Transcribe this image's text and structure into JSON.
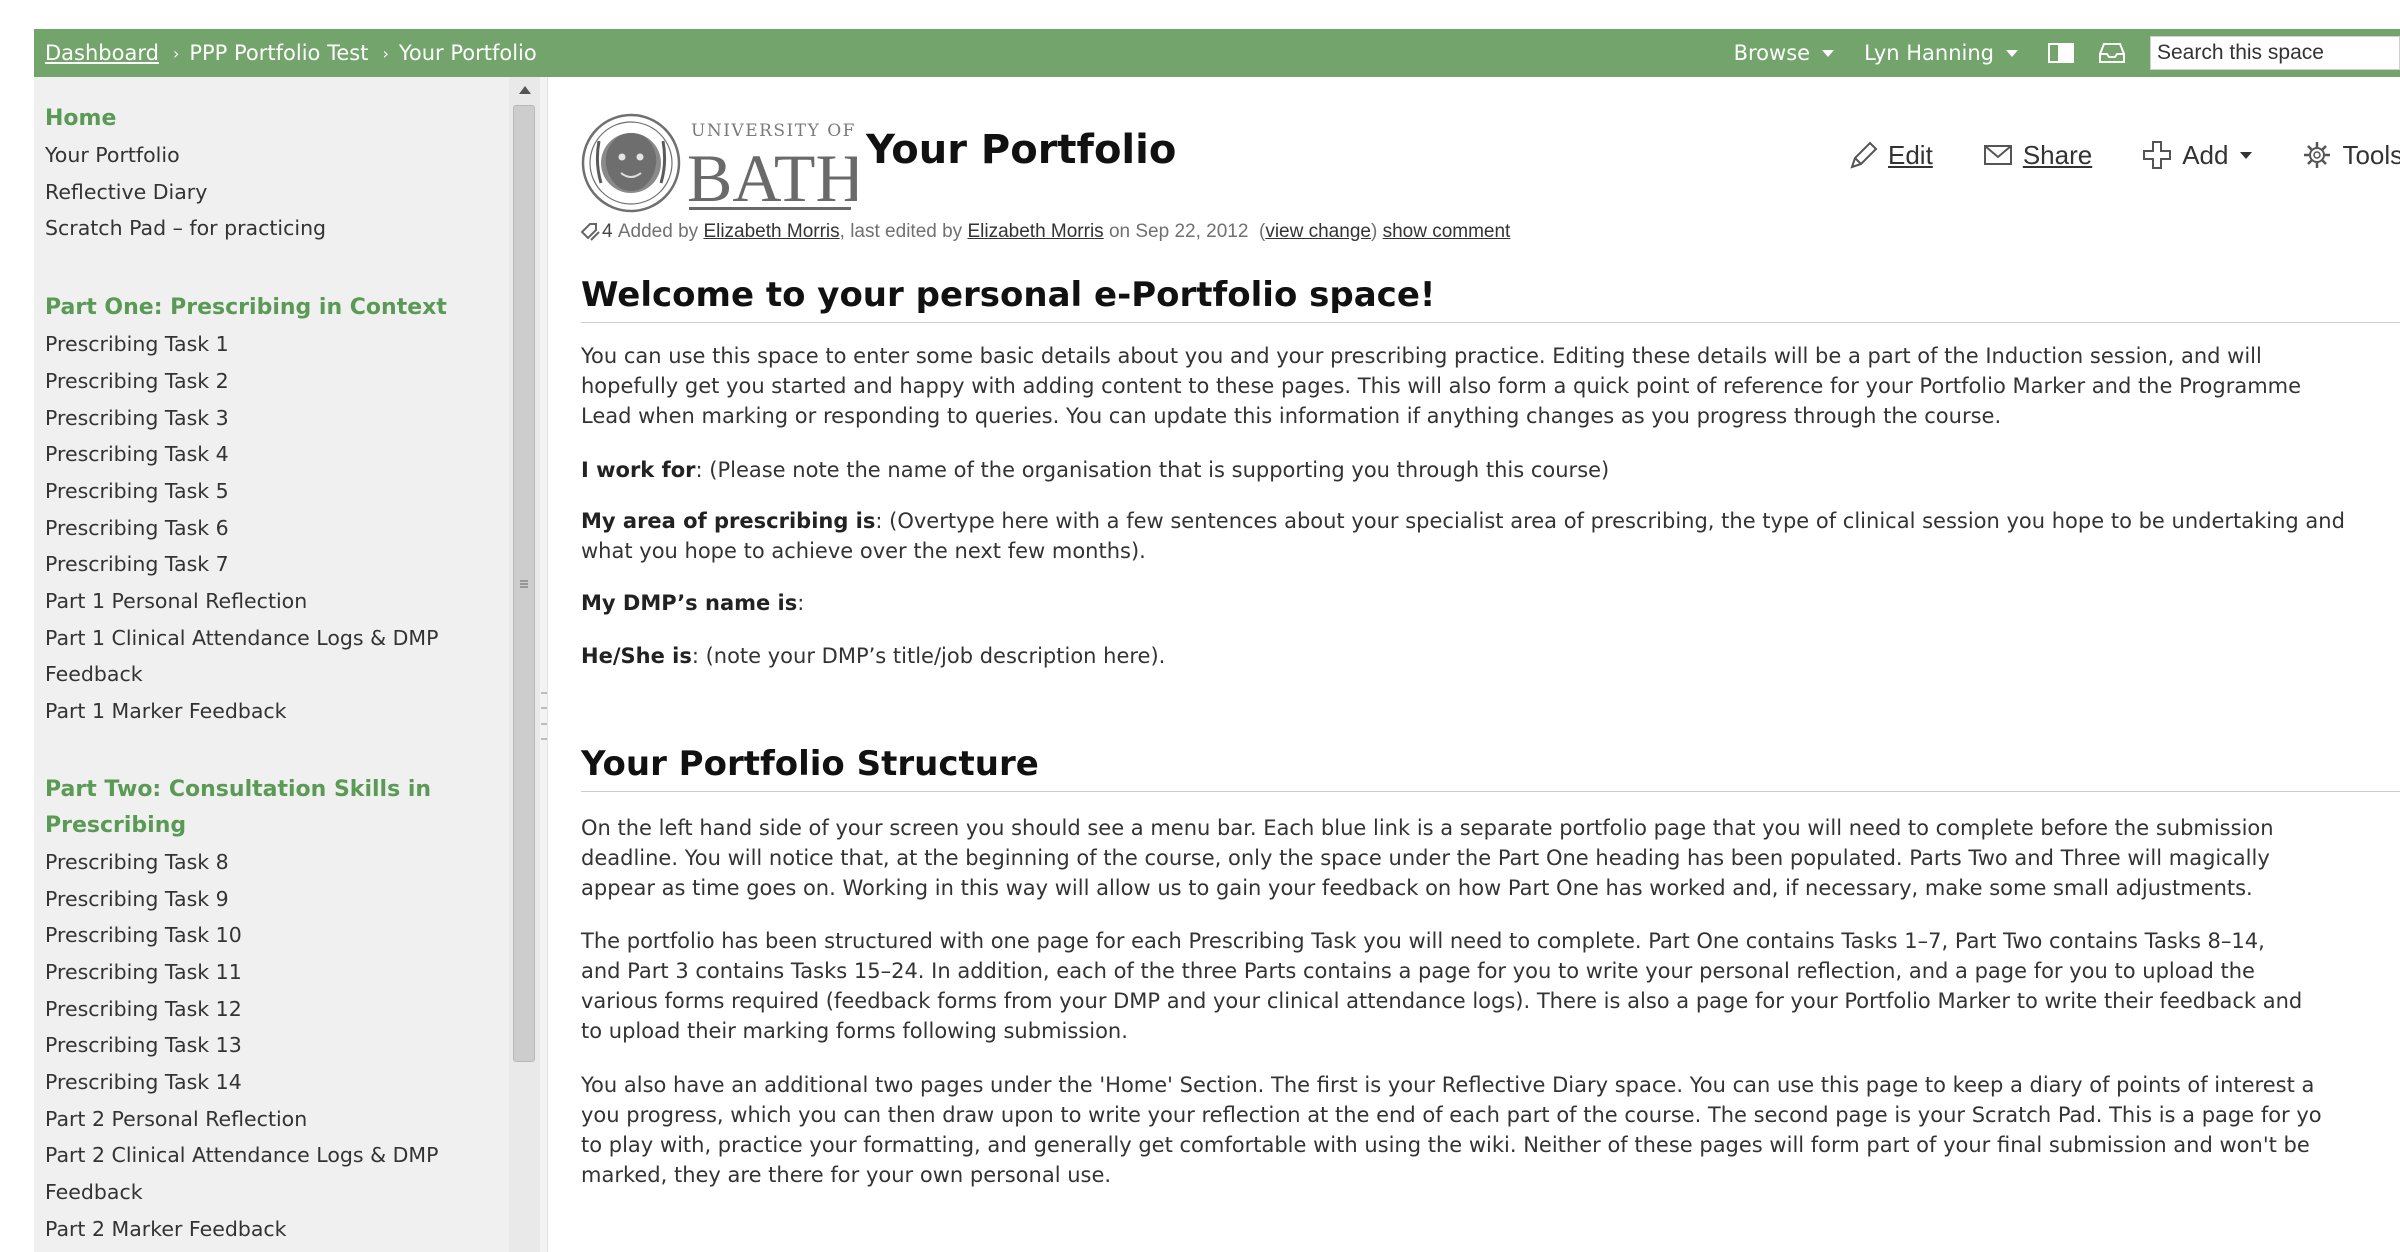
{
  "topbar": {
    "breadcrumb": [
      "Dashboard",
      "PPP Portfolio Test",
      "Your Portfolio"
    ],
    "browse_label": "Browse",
    "user_label": "Lyn Hanning",
    "search_placeholder": "Search this space",
    "color": "#72a46b"
  },
  "sidebar": {
    "sections": [
      {
        "heading": "Home",
        "items": [
          "Your Portfolio",
          "Reflective Diary",
          "Scratch Pad – for practicing"
        ]
      },
      {
        "heading": "Part One: Prescribing in Context",
        "items": [
          "Prescribing Task 1",
          "Prescribing Task 2",
          "Prescribing Task 3",
          "Prescribing Task 4",
          "Prescribing Task 5",
          "Prescribing Task 6",
          "Prescribing Task 7",
          "Part 1 Personal Reflection",
          "Part 1 Clinical Attendance Logs & DMP",
          "Feedback",
          "Part 1 Marker Feedback"
        ]
      },
      {
        "heading_lines": [
          "Part Two: Consultation Skills in",
          "Prescribing"
        ],
        "items": [
          "Prescribing Task 8",
          "Prescribing Task 9",
          "Prescribing Task 10",
          "Prescribing Task 11",
          "Prescribing Task 12",
          "Prescribing Task 13",
          "Prescribing Task 14",
          "Part 2 Personal Reflection",
          "Part 2 Clinical Attendance Logs & DMP",
          "Feedback",
          "Part 2 Marker Feedback"
        ]
      }
    ]
  },
  "page": {
    "logo_small": "UNIVERSITY OF",
    "logo_big": "BATH",
    "title": "Your Portfolio",
    "actions": {
      "edit": "Edit",
      "share": "Share",
      "add": "Add",
      "tools": "Tools"
    },
    "meta": {
      "like_count": "4",
      "added_by": "Added by",
      "author": "Elizabeth Morris",
      "edited_by": ", last edited by",
      "editor": "Elizabeth Morris",
      "on_date": "on Sep 22, 2012",
      "view_change": "view change",
      "show_comment": "show comment"
    }
  },
  "content": {
    "welcome_heading": "Welcome to your personal e-Portfolio space!",
    "intro_lines": [
      "You can use this space to enter some basic details about you and your prescribing practice. Editing these details will be a part of the Induction session, and will",
      "hopefully get you started and happy with adding content to these pages. This will also form a quick point of reference for your Portfolio Marker and the Programme",
      "Lead when marking or responding to queries. You can update this information if anything changes as you progress through the course."
    ],
    "work_for_label": "I work for",
    "work_for_text": ": (Please note the name of the organisation that is supporting you through this course)",
    "area_label": "My area of prescribing is",
    "area_text_lines": [
      ": (Overtype here with a few sentences about your specialist area of prescribing, the type of clinical session you hope to be undertaking and",
      "what you hope to achieve over the next few months)."
    ],
    "dmp_label": "My DMP’s name is",
    "dmp_text": ":",
    "hs_label": "He/She is",
    "hs_text": ": (note your DMP’s title/job description here).",
    "structure_heading": "Your Portfolio Structure",
    "structure_p1": [
      "On the left hand side of your screen you should see a menu bar. Each blue link is a separate portfolio page that you will need to complete before the submission",
      "deadline. You will notice that, at the beginning of the course, only the space under the Part One heading has been populated. Parts Two and Three will magically",
      "appear as time goes on. Working in this way will allow us to gain your feedback on how Part One has worked and, if necessary, make some small adjustments."
    ],
    "structure_p2": [
      "The portfolio has been structured with one page for each Prescribing Task you will need to complete. Part One contains Tasks 1–7, Part Two contains Tasks 8–14,",
      "and Part 3 contains Tasks 15–24. In addition, each of the three Parts contains a page for you to write your personal reflection, and a page for you to upload the",
      "various forms required (feedback forms from your DMP and your clinical attendance logs). There is also a page for your Portfolio Marker to write their feedback and",
      "to upload their marking forms following submission."
    ],
    "structure_p3": [
      "You also have an additional two pages under the 'Home' Section. The first is your Reflective Diary space. You can use this page to keep a diary of points of interest a",
      "you progress, which you can then draw upon to write your reflection at the end of each part of the course. The second page is your Scratch Pad. This is a page for yo",
      "to play with, practice your formatting, and generally get comfortable with using the wiki. Neither of these pages will form part of your final submission and won't be",
      "marked, they are there for your own personal use."
    ]
  }
}
